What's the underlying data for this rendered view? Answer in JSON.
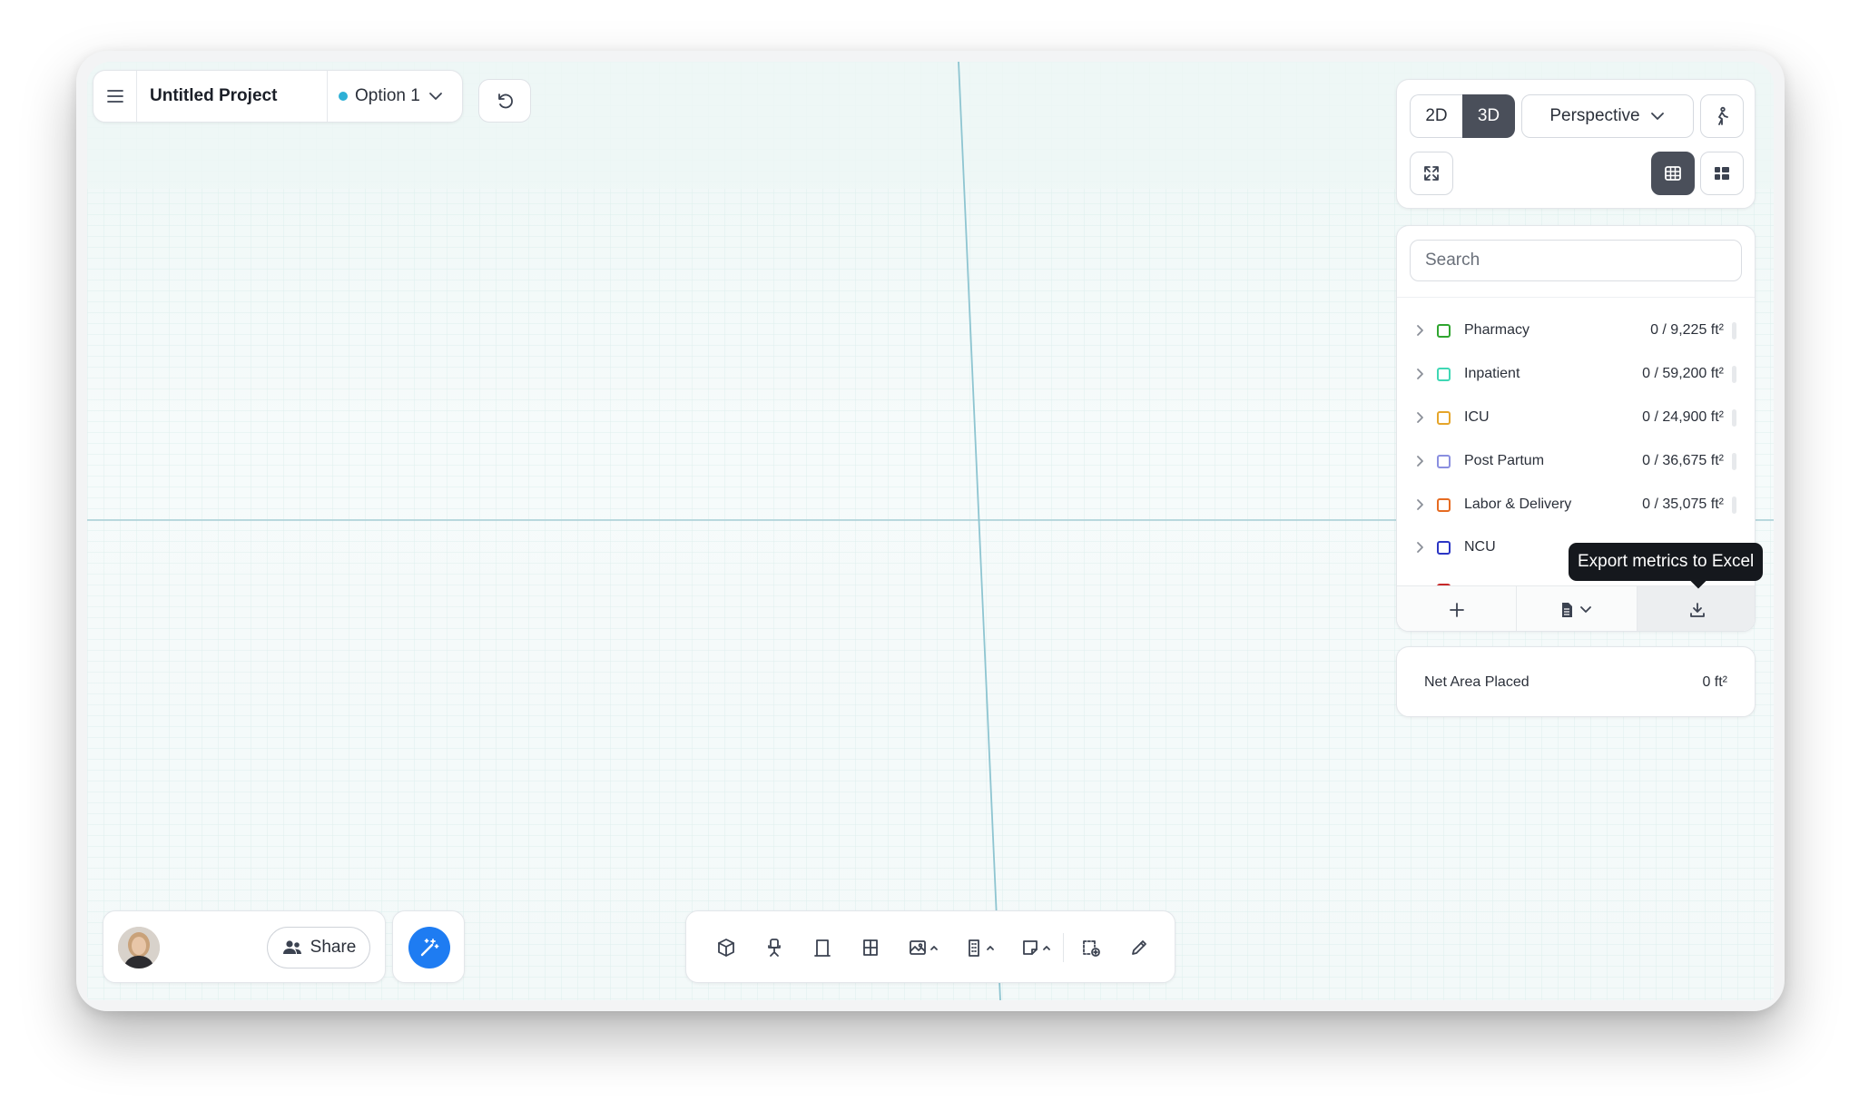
{
  "project": {
    "title": "Untitled Project",
    "option_label": "Option 1",
    "option_color": "#2eb0d6"
  },
  "view": {
    "mode_2d": "2D",
    "mode_3d": "3D",
    "active_mode": "3D",
    "camera": "Perspective",
    "layout_active": "grid"
  },
  "programs": {
    "search_placeholder": "Search",
    "items": [
      {
        "name": "Pharmacy",
        "value": "0 / 9,225 ft²",
        "color": "#2fa52f"
      },
      {
        "name": "Inpatient",
        "value": "0 / 59,200 ft²",
        "color": "#3fd7b4"
      },
      {
        "name": "ICU",
        "value": "0 / 24,900 ft²",
        "color": "#e5a52a"
      },
      {
        "name": "Post Partum",
        "value": "0 / 36,675 ft²",
        "color": "#8a8fe0"
      },
      {
        "name": "Labor & Delivery",
        "value": "0 / 35,075 ft²",
        "color": "#e66b21"
      },
      {
        "name": "NCU",
        "value": "",
        "color": "#2b35c4"
      },
      {
        "name": "",
        "value": "",
        "color": "#c62828"
      }
    ],
    "tooltip": "Export metrics to Excel"
  },
  "metrics": {
    "net_area_label": "Net Area Placed",
    "net_area_value": "0 ft²"
  },
  "collab": {
    "share_label": "Share"
  },
  "toolbar": {
    "tools": [
      "box-icon",
      "chair-icon",
      "door-icon",
      "window-icon",
      "image-icon",
      "building-icon",
      "note-icon",
      "room-add-icon",
      "pencil-icon"
    ]
  },
  "colors": {
    "accent": "#1e7cf2",
    "dark": "#4a4f5a",
    "tooltip_bg": "#15181d"
  }
}
